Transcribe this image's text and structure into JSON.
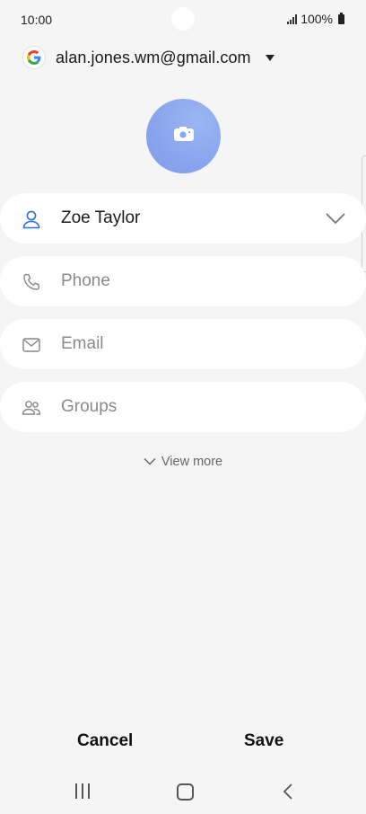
{
  "status_bar": {
    "time": "10:00",
    "battery": "100%"
  },
  "account": {
    "email": "alan.jones.wm@gmail.com",
    "logo_icon": "google-logo-icon",
    "dropdown_icon": "caret-down-icon"
  },
  "avatar": {
    "icon": "camera-icon",
    "color": "#8aa6ee"
  },
  "fields": {
    "name": {
      "value": "Zoe Taylor",
      "icon": "person-icon",
      "expand_icon": "chevron-down-icon",
      "icon_color": "#2f6fe0"
    },
    "phone": {
      "placeholder": "Phone",
      "icon": "phone-icon"
    },
    "email": {
      "placeholder": "Email",
      "icon": "mail-icon"
    },
    "groups": {
      "placeholder": "Groups",
      "icon": "people-icon"
    }
  },
  "view_more_label": "View more",
  "footer": {
    "cancel_label": "Cancel",
    "save_label": "Save"
  },
  "nav": {
    "recent_icon": "recent-apps-icon",
    "home_icon": "home-icon",
    "back_icon": "back-icon"
  }
}
